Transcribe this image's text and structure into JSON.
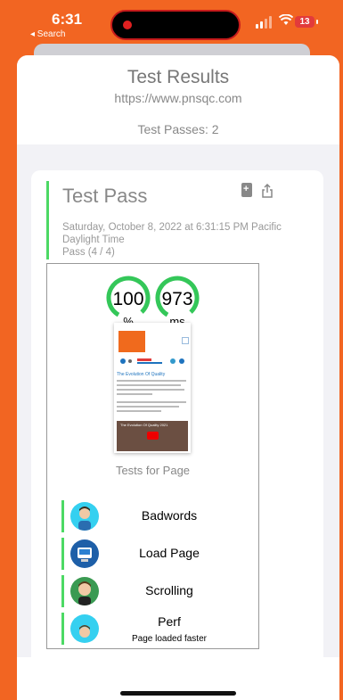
{
  "status_bar": {
    "time": "6:31",
    "back_label": "◂ Search",
    "battery": "13",
    "icons": [
      "signal-icon",
      "wifi-icon",
      "battery-icon"
    ]
  },
  "header": {
    "title": "Test Results",
    "url": "https://www.pnsqc.com",
    "test_passes": "Test Passes: 2"
  },
  "test_pass": {
    "title": "Test Pass",
    "date": "Saturday, October 8, 2022 at 6:31:15 PM Pacific Daylight Time",
    "result": "Pass (4 / 4)",
    "action_icons": [
      "add-document-icon",
      "share-icon"
    ]
  },
  "metrics": [
    {
      "value": "100",
      "unit": "%",
      "color": "#34c759"
    },
    {
      "value": "973",
      "unit": "ms",
      "color": "#34c759"
    }
  ],
  "thumbnail": {
    "headline": "The Evolution Of Quality",
    "video_title": "The Evolution Of Quality 2021"
  },
  "tests_for_page": "Tests for Page",
  "tests": [
    {
      "name": "Badwords",
      "sub": ""
    },
    {
      "name": "Load Page",
      "sub": ""
    },
    {
      "name": "Scrolling",
      "sub": ""
    },
    {
      "name": "Perf",
      "sub": "Page loaded faster"
    }
  ],
  "colors": {
    "accent_orange": "#f26522",
    "pass_green": "#4cd964"
  }
}
